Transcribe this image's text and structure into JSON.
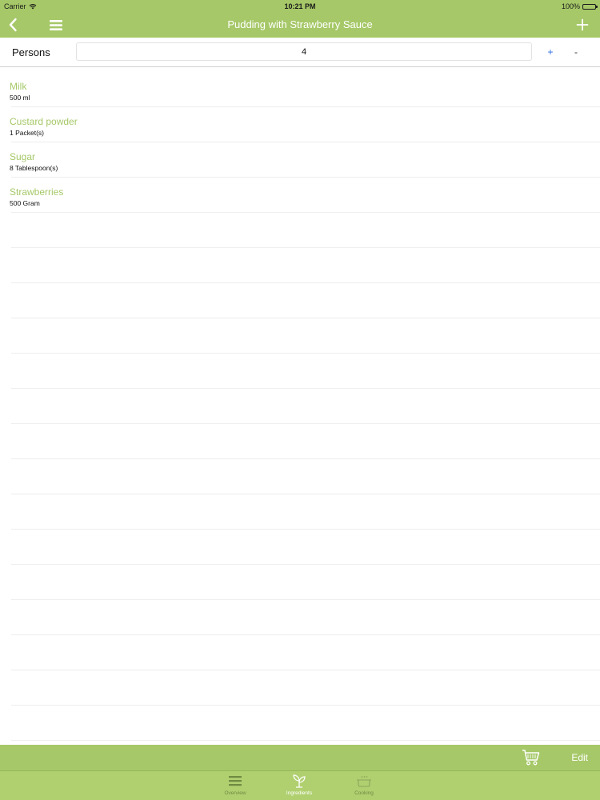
{
  "status_bar": {
    "carrier": "Carrier",
    "time": "10:21 PM",
    "battery": "100%"
  },
  "nav": {
    "title": "Pudding with Strawberry Sauce",
    "back_icon": "chevron-left-icon",
    "menu_icon": "hamburger-menu-icon",
    "add_icon": "plus-icon"
  },
  "persons": {
    "label": "Persons",
    "value": "4",
    "plus_label": "+",
    "minus_label": "-"
  },
  "ingredients": [
    {
      "name": "Milk",
      "amount": "500 ml"
    },
    {
      "name": "Custard powder",
      "amount": "1 Packet(s)"
    },
    {
      "name": "Sugar",
      "amount": "8 Tablespoon(s)"
    },
    {
      "name": "Strawberries",
      "amount": "500 Gram"
    },
    {
      "name": "",
      "amount": ""
    },
    {
      "name": "",
      "amount": ""
    },
    {
      "name": "",
      "amount": ""
    },
    {
      "name": "",
      "amount": ""
    },
    {
      "name": "",
      "amount": ""
    },
    {
      "name": "",
      "amount": ""
    },
    {
      "name": "",
      "amount": ""
    },
    {
      "name": "",
      "amount": ""
    },
    {
      "name": "",
      "amount": ""
    },
    {
      "name": "",
      "amount": ""
    },
    {
      "name": "",
      "amount": ""
    },
    {
      "name": "",
      "amount": ""
    },
    {
      "name": "",
      "amount": ""
    },
    {
      "name": "",
      "amount": ""
    },
    {
      "name": "",
      "amount": ""
    }
  ],
  "toolbar": {
    "cart_icon": "shopping-cart-icon",
    "edit_label": "Edit"
  },
  "tabs": [
    {
      "label": "Overview",
      "icon": "list-icon",
      "active": false
    },
    {
      "label": "Ingredients",
      "icon": "sprout-icon",
      "active": true
    },
    {
      "label": "Cooking",
      "icon": "pot-icon",
      "active": false
    }
  ],
  "colors": {
    "accent": "#a6c868",
    "tab_bar": "#b0d070",
    "link_blue": "#2d6be0"
  }
}
